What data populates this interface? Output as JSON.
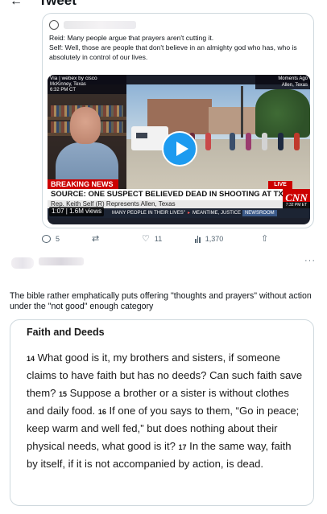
{
  "header": {
    "back_glyph": "←",
    "title": "Tweet"
  },
  "quoted_tweet": {
    "avatar_icon": "profile-avatar-icon",
    "line1": "Reid: Many people argue that prayers aren't cutting it.",
    "line2": "Self: Well, those are people that don't believe in an almighty god who has, who is absolutely in control of our lives.",
    "video": {
      "cam_line1": "Via | webex by cisco",
      "cam_line2": "McKinney, Texas",
      "cam_line3": "6:32 PM CT",
      "time_line1": "Moments Ago",
      "time_line2": "Allen, Texas",
      "breaking_label": "BREAKING NEWS",
      "live_label": "LIVE",
      "headline": "SOURCE: ONE SUSPECT BELIEVED DEAD IN SHOOTING AT TX MALL",
      "subline": "Rep. Keith Self (R) Represents Allen, Texas",
      "network_logo": "CNN",
      "network_time": "7:32 PM ET",
      "ticker_1": "MANY PEOPLE IN THEIR LIVES\"",
      "ticker_2": "MEANTIME, JUSTICE",
      "ticker_3": "NEWSROOM",
      "views_label": "1:07 | 1.6M views"
    }
  },
  "actions": {
    "replies": "5",
    "retweets": "",
    "likes": "11",
    "views": "1,370"
  },
  "reply": {
    "text": "The bible rather emphatically puts offering \"thoughts and prayers\" without action under the \"not good\" enough category"
  },
  "verse_card": {
    "title": "Faith and Deeds",
    "v14_num": "14",
    "v14": " What good is it, my brothers and sisters, if someone claims to have faith but has no deeds? Can such faith save them? ",
    "v15_num": "15",
    "v15": " Suppose a brother or a sister is without clothes and daily food. ",
    "v16_num": "16",
    "v16": " If one of you says to them, “Go in peace; keep warm and well fed,” but does nothing about their physical needs, what good is it? ",
    "v17_num": "17",
    "v17": " In the same way, faith by itself, if it is not accompanied by action, is dead."
  }
}
